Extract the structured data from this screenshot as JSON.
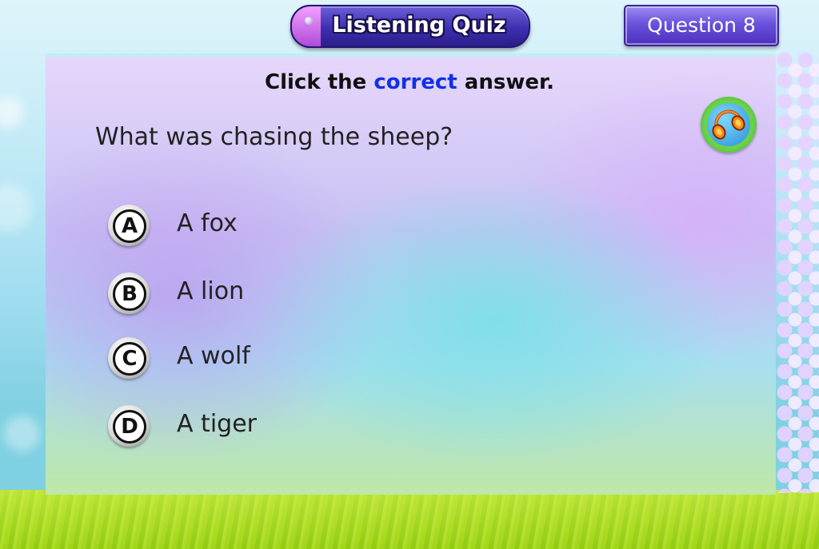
{
  "header": {
    "title": "Listening Quiz",
    "question_number": "Question 8"
  },
  "instruction": {
    "before": "Click the ",
    "accent": "correct",
    "after": " answer."
  },
  "question": "What was chasing the sheep?",
  "audio_button": {
    "icon": "headphones-icon"
  },
  "options": [
    {
      "letter": "A",
      "text": "A fox"
    },
    {
      "letter": "B",
      "text": "A lion"
    },
    {
      "letter": "C",
      "text": "A wolf"
    },
    {
      "letter": "D",
      "text": "A tiger"
    }
  ],
  "colors": {
    "accent": "#1230e6",
    "title_pill": "#3e2fb0",
    "badge": "#6a52dc",
    "audio_ring": "#6bd24a",
    "grass": "#a6d91e"
  }
}
